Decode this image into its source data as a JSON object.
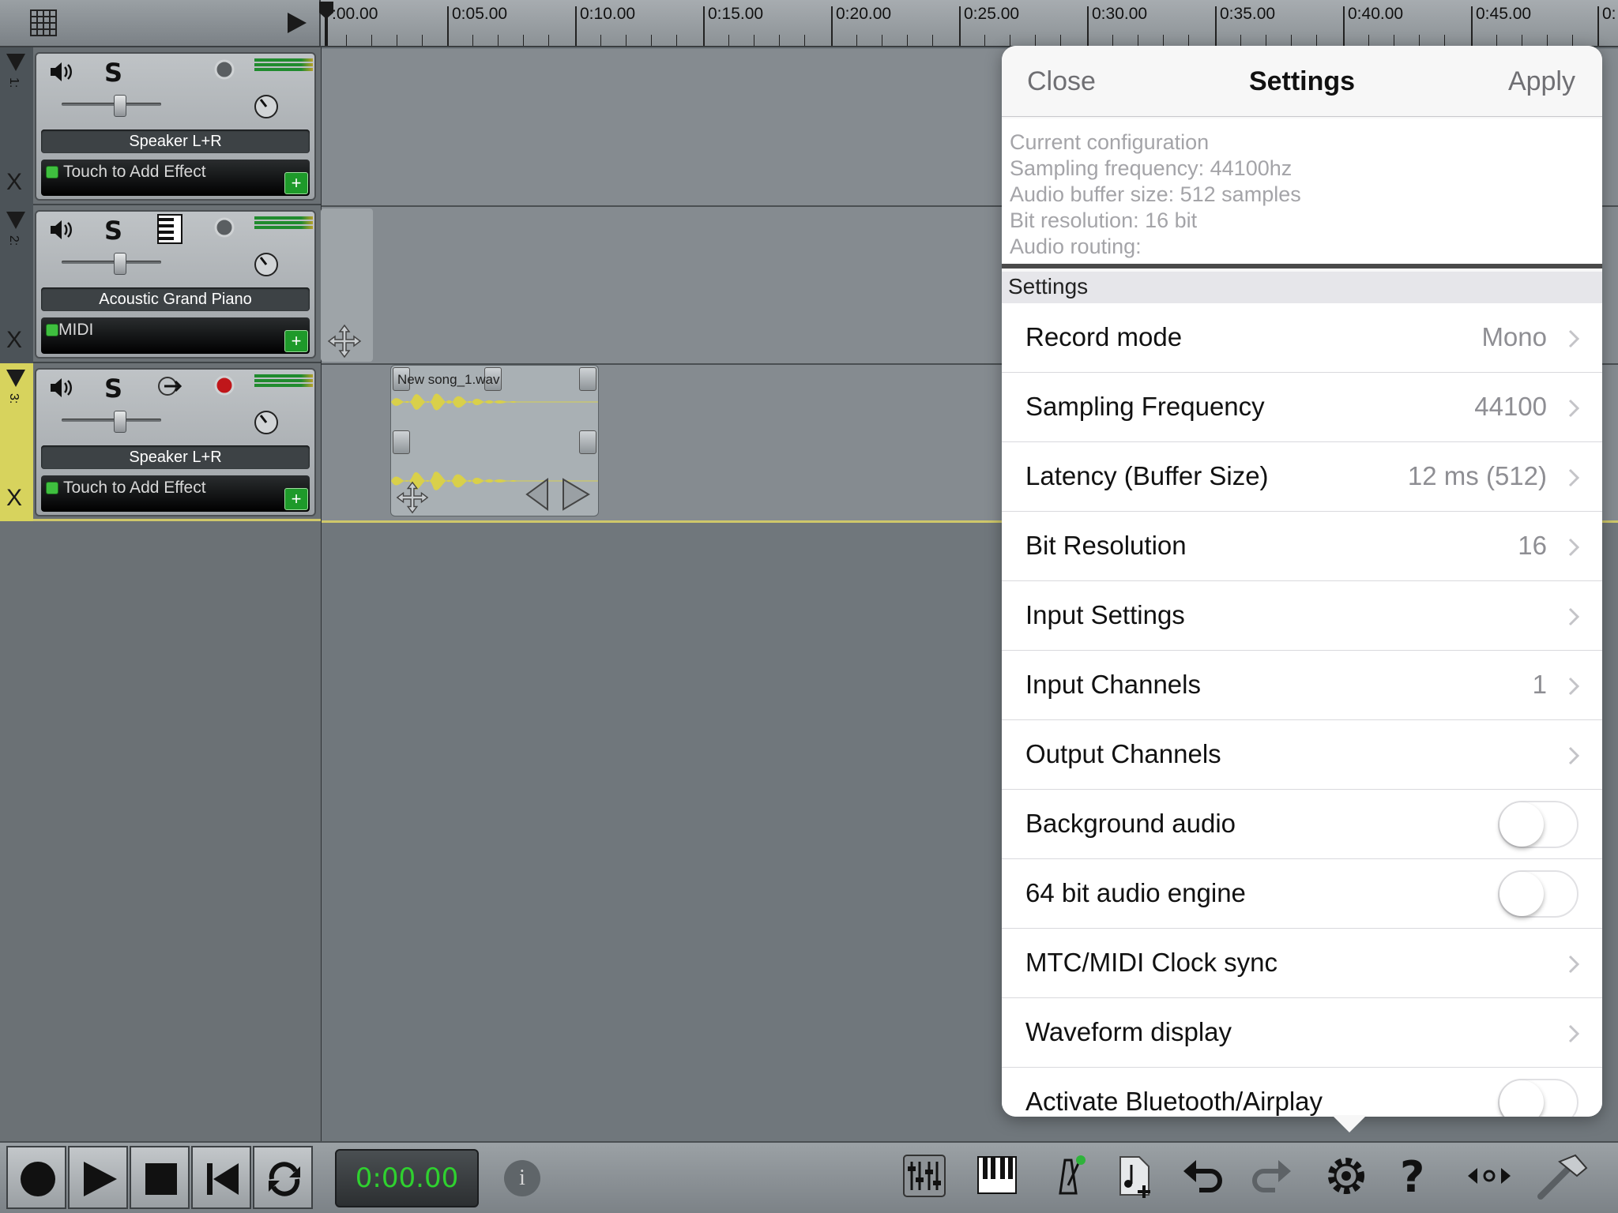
{
  "ruler": {
    "ticks": [
      ":00.00",
      "0:05.00",
      "0:10.00",
      "0:15.00",
      "0:20.00",
      "0:25.00",
      "0:30.00",
      "0:35.00",
      "0:40.00",
      "0:45.00",
      "0:"
    ]
  },
  "tracks": [
    {
      "number": "1:",
      "x": "X",
      "name": "Speaker L+R",
      "effect": "Touch to Add Effect",
      "add": "+"
    },
    {
      "number": "2:",
      "x": "X",
      "name": "Acoustic Grand Piano",
      "effect": "MIDI",
      "add": "+"
    },
    {
      "number": "3:",
      "x": "X",
      "name": "Speaker L+R",
      "effect": "Touch to Add Effect",
      "add": "+"
    }
  ],
  "clip": {
    "name": "New song_1.wav"
  },
  "toolbar": {
    "time": "0:00.00",
    "info": "i"
  },
  "settings": {
    "close_label": "Close",
    "title": "Settings",
    "apply_label": "Apply",
    "config": [
      "Current configuration",
      "Sampling frequency: 44100hz",
      "Audio buffer size: 512 samples",
      "Bit resolution: 16 bit",
      "Audio routing:"
    ],
    "section": "Settings",
    "rows": [
      {
        "label": "Record mode",
        "value": "Mono"
      },
      {
        "label": "Sampling Frequency",
        "value": "44100"
      },
      {
        "label": "Latency (Buffer Size)",
        "value": "12 ms (512)"
      },
      {
        "label": "Bit Resolution",
        "value": "16"
      },
      {
        "label": "Input Settings",
        "value": ""
      },
      {
        "label": "Input Channels",
        "value": "1"
      },
      {
        "label": "Output Channels",
        "value": ""
      },
      {
        "label": "Background audio",
        "toggle": false
      },
      {
        "label": "64 bit audio engine",
        "toggle": false
      },
      {
        "label": "MTC/MIDI Clock sync",
        "value": ""
      },
      {
        "label": "Waveform display",
        "value": ""
      },
      {
        "label": "Activate Bluetooth/Airplay",
        "toggle": false
      }
    ]
  },
  "colors": {
    "meter_green": "#208b2e",
    "armed_yellow": "#d7d35d",
    "time_green": "#2fd12f",
    "record_red": "#c0161a"
  }
}
